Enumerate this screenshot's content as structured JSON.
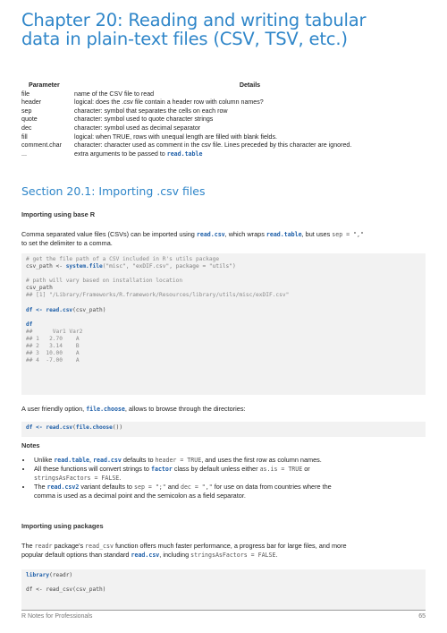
{
  "chapter_title_line1": "Chapter 20: Reading and writing tabular",
  "chapter_title_line2": "data in plain-text files (CSV, TSV, etc.)",
  "param_table": {
    "header_param": "Parameter",
    "header_details": "Details",
    "rows": [
      {
        "param": "file",
        "details": "name of the CSV file to read"
      },
      {
        "param": "header",
        "details": "logical: does the .csv file contain a header row with column names?"
      },
      {
        "param": "sep",
        "details": "character: symbol that separates the cells on each row"
      },
      {
        "param": "quote",
        "details": "character: symbol used to quote character strings"
      },
      {
        "param": "dec",
        "details": "character: symbol used as decimal separator"
      },
      {
        "param": "fill",
        "details": "logical: when TRUE, rows with unequal length are filled with blank fields."
      },
      {
        "param": "comment.char",
        "details": "character: character used as comment in the csv file. Lines preceded by this character are ignored."
      },
      {
        "param": "...",
        "details": "extra arguments to be passed to ",
        "details_code": "read.table"
      }
    ]
  },
  "section_title": "Section 20.1: Importing .csv files",
  "sub1": "Importing using base R",
  "para1": {
    "t1": "Comma separated value files (CSVs) can be imported using ",
    "c1": "read.csv",
    "t2": ", which wraps ",
    "c2": "read.table",
    "t3": ", but uses ",
    "c3": "sep = \",\"",
    "t4": "to set the delimiter to a comma."
  },
  "code1": {
    "l1": "# get the file path of a CSV included in R's utils package",
    "l2a": "csv_path <- ",
    "l2b": "system.file",
    "l2c": "(\"misc\", \"exDIF.csv\", package = \"utils\")",
    "l3": "# path will vary based on installation location",
    "l4": "csv_path",
    "l5": "## [1] \"/Library/Frameworks/R.framework/Resources/library/utils/misc/exDIF.csv\"",
    "l6a": "df <- ",
    "l6b": "read.csv",
    "l6c": "(csv_path)",
    "l7": "df",
    "l8": "##      Var1 Var2",
    "l9": "## 1   2.70    A",
    "l10": "## 2   3.14    B",
    "l11": "## 3  10.00    A",
    "l12": "## 4  -7.00    A"
  },
  "para2": {
    "t1": "A user friendly option, ",
    "c1": "file.choose",
    "t2": ", allows to browse through the directories:"
  },
  "code2": {
    "a": "df <- ",
    "b": "read.csv",
    "c": "(",
    "d": "file.choose",
    "e": "())"
  },
  "notes_label": "Notes",
  "notes": {
    "n1": {
      "t1": "Unlike ",
      "c1": "read.table",
      "t2": ", ",
      "c2": "read.csv",
      "t3": " defaults to ",
      "c3": "header = TRUE",
      "t4": ", and uses the first row as column names."
    },
    "n2": {
      "t1": "All these functions will convert strings to ",
      "c1": "factor",
      "t2": " class by default unless either ",
      "c2": "as.is = TRUE",
      "t3": " or",
      "c3": "stringsAsFactors = FALSE",
      "t4": "."
    },
    "n3": {
      "t1": "The ",
      "c1": "read.csv2",
      "t2": " variant defaults to ",
      "c2": "sep = \";\"",
      "t3": " and ",
      "c3": "dec = \",\"",
      "t4": " for use on data from countries where the",
      "t5": "comma is used as a decimal point and the semicolon as a field separator."
    }
  },
  "sub2": "Importing using packages",
  "para3": {
    "t1": "The ",
    "c1": "readr",
    "t2": " package's ",
    "c2": "read_csv",
    "t3": " function offers much faster performance, a progress bar for large files, and more",
    "t4": "popular default options than standard ",
    "c3": "read.csv",
    "t5": ", including ",
    "c4": "stringsAsFactors = FALSE",
    "t6": "."
  },
  "code3": {
    "a": "library",
    "b": "(readr)",
    "c": "df <- read_csv(csv_path)"
  },
  "footer": {
    "left": "R Notes for Professionals",
    "right": "65"
  }
}
